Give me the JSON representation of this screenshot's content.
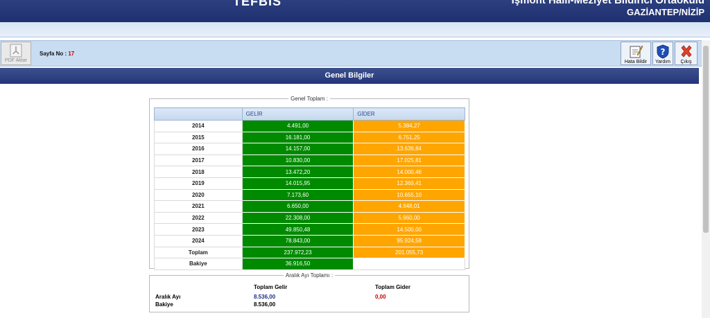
{
  "header": {
    "app_title": "TEFBİS",
    "school_name": "İşmont Halil-Meziyet Bildirici Ortaokulu",
    "school_location": "GAZİANTEP/NİZİP"
  },
  "toolbar": {
    "pdf_label": "PDF Aktar",
    "page_label": "Sayfa No :",
    "page_number": "17",
    "error_report_label": "Hata Bildir",
    "help_label": "Yardım",
    "exit_label": "Çıkış"
  },
  "section_title": "Genel Bilgiler",
  "genel_toplam": {
    "legend": "Genel Toplam :",
    "headers": {
      "year": "",
      "gelir": "GELİR",
      "gider": "GİDER"
    },
    "rows": [
      {
        "year": "2014",
        "gelir": "4.491,00",
        "gider": "5.384,27"
      },
      {
        "year": "2015",
        "gelir": "16.181,00",
        "gider": "6.751,25"
      },
      {
        "year": "2016",
        "gelir": "14.157,00",
        "gider": "13.636,84"
      },
      {
        "year": "2017",
        "gelir": "10.830,00",
        "gider": "17.025,81"
      },
      {
        "year": "2018",
        "gelir": "13.472,20",
        "gider": "14.000,46"
      },
      {
        "year": "2019",
        "gelir": "14.015,95",
        "gider": "12.369,41"
      },
      {
        "year": "2020",
        "gelir": "7.173,60",
        "gider": "10.655,10"
      },
      {
        "year": "2021",
        "gelir": "6.650,00",
        "gider": "4.848,01"
      },
      {
        "year": "2022",
        "gelir": "22.308,00",
        "gider": "5.960,00"
      },
      {
        "year": "2023",
        "gelir": "49.850,48",
        "gider": "14.500,00"
      },
      {
        "year": "2024",
        "gelir": "78.843,00",
        "gider": "95.924,58"
      }
    ],
    "total_row": {
      "label": "Toplam",
      "gelir": "237.972,23",
      "gider": "201.055,73"
    },
    "balance_row": {
      "label": "Bakiye",
      "gelir": "36.916,50"
    }
  },
  "aralik": {
    "legend": "Aralık Ayı Toplamı :",
    "col_gelir": "Toplam Gelir",
    "col_gider": "Toplam Gider",
    "row_month_label": "Aralık Ayı",
    "month_gelir": "8.536,00",
    "month_gider": "0,00",
    "row_balance_label": "Bakiye",
    "balance_value": "8.536,00"
  },
  "colors": {
    "header_bg": "#24367a",
    "gelir_cell": "#008a00",
    "gider_cell": "#ffa500",
    "income_text": "#1f2f8a",
    "expense_text": "#c00000"
  }
}
